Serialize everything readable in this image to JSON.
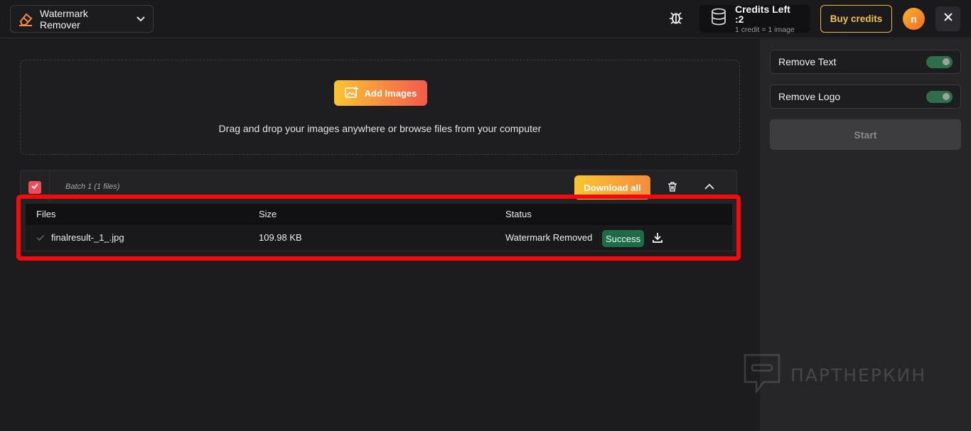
{
  "header": {
    "app_title": "Watermark Remover",
    "credits_main": "Credits Left :2",
    "credits_sub": "1 credit = 1 image",
    "buy_label": "Buy credits",
    "avatar_initial": "п"
  },
  "dropzone": {
    "add_label": "Add Images",
    "hint": "Drag and drop your images anywhere or browse files from your computer"
  },
  "batch": {
    "label": "Batch 1 (1 files)",
    "download_all_label": "Download all",
    "checked": true,
    "columns": [
      "Files",
      "Size",
      "Status"
    ],
    "rows": [
      {
        "file": "finalresult-_1_.jpg",
        "size": "109.98 KB",
        "status": "Watermark Removed",
        "badge": "Success"
      }
    ]
  },
  "panel": {
    "remove_text_label": "Remove Text",
    "remove_text_on": true,
    "remove_logo_label": "Remove Logo",
    "remove_logo_on": true,
    "start_label": "Start"
  },
  "watermark_text": "ПАРТНЕРКИН",
  "colors": {
    "accent_gradient_start": "#fbc531",
    "accent_gradient_end": "#f35a4d",
    "success": "#1f6b47",
    "highlight": "#f40a0a"
  }
}
